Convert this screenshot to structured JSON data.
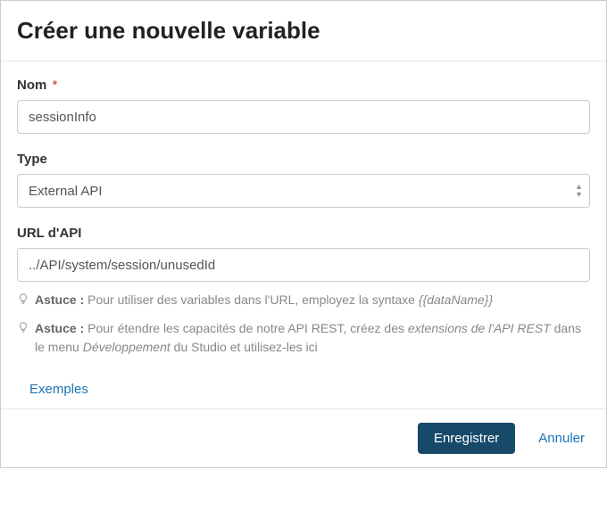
{
  "modal": {
    "title": "Créer une nouvelle variable"
  },
  "form": {
    "name": {
      "label": "Nom",
      "value": "sessionInfo",
      "required_marker": "*"
    },
    "type": {
      "label": "Type",
      "value": "External API"
    },
    "apiUrl": {
      "label": "URL d'API",
      "value": "../API/system/session/unusedId"
    }
  },
  "hints": {
    "tip_label": "Astuce :",
    "line1_text": "Pour utiliser des variables dans l'URL, employez la syntaxe ",
    "line1_var": "{{dataName}}",
    "line2_text_a": "Pour étendre les capacités de notre API REST, créez des ",
    "line2_em_a": "extensions de l'API REST",
    "line2_text_b": " dans le menu ",
    "line2_em_b": "Développement",
    "line2_text_c": " du Studio et utilisez-les ici"
  },
  "links": {
    "examples": "Exemples"
  },
  "footer": {
    "save": "Enregistrer",
    "cancel": "Annuler"
  }
}
